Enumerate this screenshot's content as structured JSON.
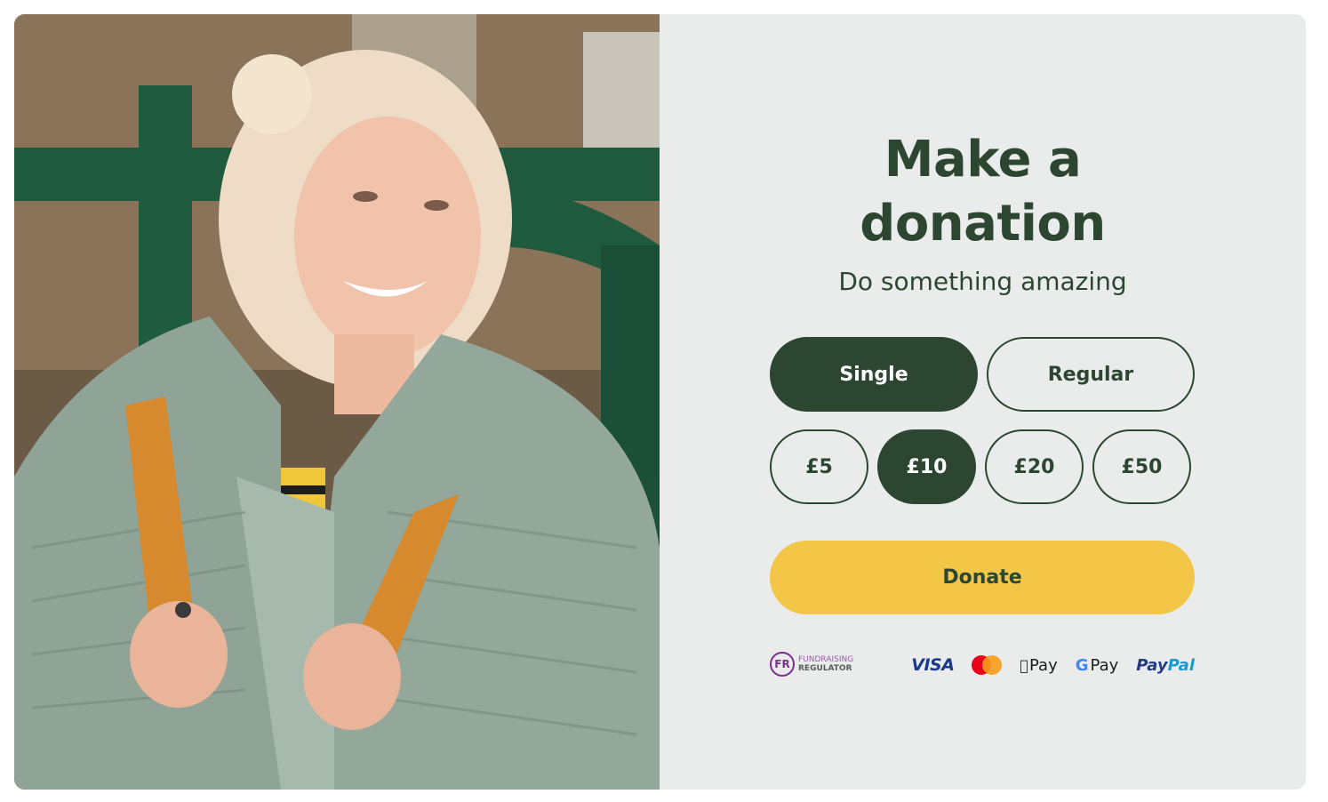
{
  "hero_image": {
    "alt_label": "photo-smiling-woman"
  },
  "panel": {
    "title_line1": "Make a",
    "title_line2": "donation",
    "subtitle": "Do something amazing"
  },
  "frequency": {
    "options": [
      "Single",
      "Regular"
    ],
    "selected": "Single"
  },
  "amounts": {
    "options": [
      "£5",
      "£10",
      "£20",
      "£50"
    ],
    "selected": "£10"
  },
  "donate_button": {
    "label": "Donate"
  },
  "footer": {
    "fr_badge": "FR",
    "fr_line1": "FUNDRAISING",
    "fr_line2": "REGULATOR",
    "payment_methods": {
      "visa": "VISA",
      "mastercard_icon": "mastercard-icon",
      "apple_pay": "Pay",
      "google_pay": "Pay",
      "paypal_pay": "Pay",
      "paypal_pal": "Pal"
    }
  },
  "colors": {
    "brand_green": "#2c4632",
    "donate_yellow": "#f3c647",
    "panel_bg": "#eaeceb",
    "fr_purple": "#7b2e8e"
  }
}
